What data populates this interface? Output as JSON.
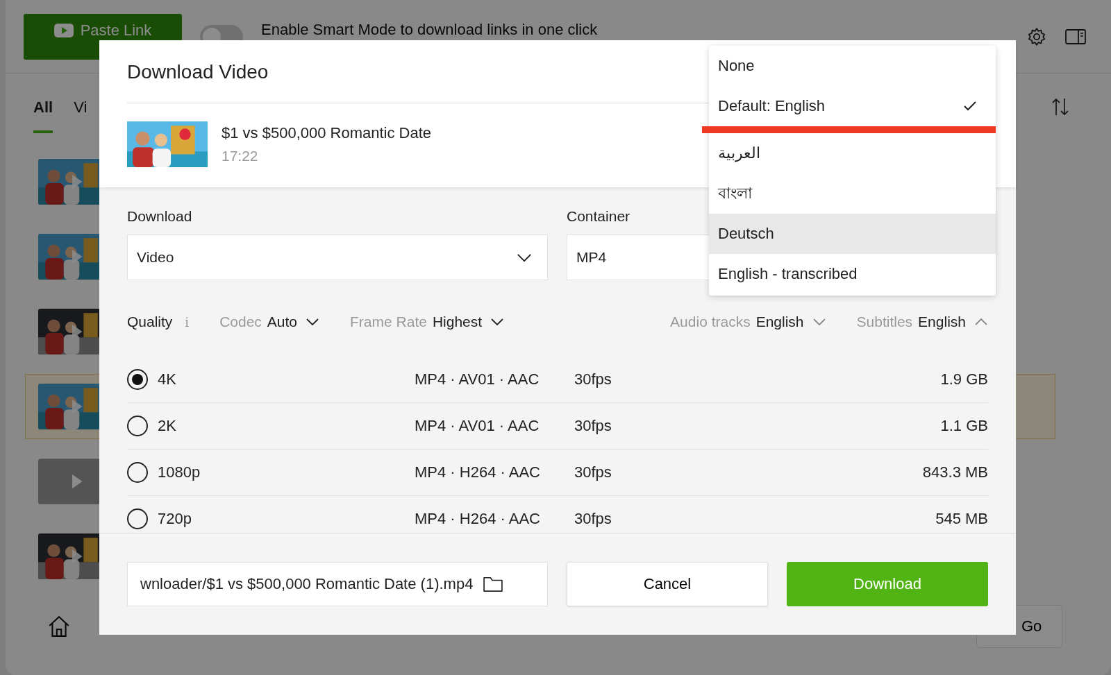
{
  "app": {
    "paste_button": "Paste Link",
    "smart_mode": {
      "on": false,
      "label": "Enable Smart Mode to download links in one click"
    },
    "tabs": [
      {
        "label": "All",
        "selected": true
      },
      {
        "label": "Vi",
        "selected": false
      }
    ],
    "items": [
      {
        "kind": "picture",
        "highlighted": false
      },
      {
        "kind": "picture",
        "highlighted": false
      },
      {
        "kind": "picture",
        "highlighted": false
      },
      {
        "kind": "picture",
        "highlighted": true
      },
      {
        "kind": "placeholder",
        "highlighted": false
      },
      {
        "kind": "picture",
        "highlighted": false
      }
    ],
    "go_button": "Go"
  },
  "dialog": {
    "title": "Download Video",
    "video": {
      "title": "$1 vs $500,000 Romantic Date",
      "duration": "17:22"
    },
    "download": {
      "label": "Download",
      "value": "Video"
    },
    "container": {
      "label": "Container",
      "value": "MP4"
    },
    "filters": [
      {
        "kind": "info",
        "label": "Quality",
        "icon": "i"
      },
      {
        "kind": "select",
        "label": "Codec",
        "value": "Auto",
        "expanded": false
      },
      {
        "kind": "select",
        "label": "Frame Rate",
        "value": "Highest",
        "expanded": false
      },
      {
        "kind": "spacer"
      },
      {
        "kind": "select",
        "label": "Audio tracks",
        "value": "English",
        "expanded": false
      },
      {
        "kind": "select",
        "label": "Subtitles",
        "value": "English",
        "expanded": true
      }
    ],
    "formats": [
      {
        "quality": "4K",
        "codec": "MP4 · AV01 · AAC",
        "fps": "30fps",
        "size": "1.9 GB",
        "selected": true
      },
      {
        "quality": "2K",
        "codec": "MP4 · AV01 · AAC",
        "fps": "30fps",
        "size": "1.1 GB",
        "selected": false
      },
      {
        "quality": "1080p",
        "codec": "MP4 · H264 · AAC",
        "fps": "30fps",
        "size": "843.3 MB",
        "selected": false
      },
      {
        "quality": "720p",
        "codec": "MP4 · H264 · AAC",
        "fps": "30fps",
        "size": "545 MB",
        "selected": false
      }
    ],
    "path": "wnloader/$1 vs $500,000 Romantic Date (1).mp4",
    "cancel": "Cancel",
    "download_button": "Download"
  },
  "subtitle_menu": [
    {
      "label": "None",
      "selected": false,
      "hovered": false,
      "underlined": false
    },
    {
      "label": "Default: English",
      "selected": true,
      "hovered": false,
      "underlined": true
    },
    {
      "label": "العربية",
      "selected": false,
      "hovered": false,
      "underlined": false
    },
    {
      "label": "বাংলা",
      "selected": false,
      "hovered": false,
      "underlined": false
    },
    {
      "label": "Deutsch",
      "selected": false,
      "hovered": true,
      "underlined": false
    },
    {
      "label": "English - transcribed",
      "selected": false,
      "hovered": false,
      "underlined": false
    }
  ]
}
